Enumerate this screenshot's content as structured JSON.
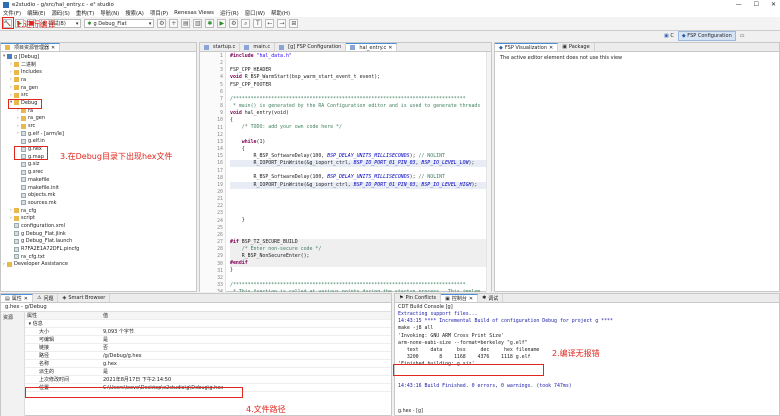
{
  "window": {
    "title": "e2studio - g/src/hal_entry.c - e² studio"
  },
  "menu": [
    "文件(F)",
    "编辑(E)",
    "源码(S)",
    "重构(T)",
    "导航(N)",
    "搜索(A)",
    "项目(P)",
    "Renesas Views",
    "运行(R)",
    "窗口(W)",
    "帮助(H)"
  ],
  "toolbar": {
    "mode": "调试(B)",
    "config": "g Debug_Flat"
  },
  "project_explorer": {
    "title": "项目资源管理器",
    "items": [
      {
        "d": 0,
        "t": "▾",
        "icon": "proj",
        "label": "g [Debug]"
      },
      {
        "d": 1,
        "t": "›",
        "icon": "folder",
        "label": "二进制"
      },
      {
        "d": 1,
        "t": "›",
        "icon": "folder",
        "label": "Includes"
      },
      {
        "d": 1,
        "t": "›",
        "icon": "folder",
        "label": "ra"
      },
      {
        "d": 1,
        "t": "›",
        "icon": "folder",
        "label": "ra_gen"
      },
      {
        "d": 1,
        "t": "›",
        "icon": "folder",
        "label": "src"
      },
      {
        "d": 1,
        "t": "▾",
        "icon": "folder",
        "label": "Debug"
      },
      {
        "d": 2,
        "t": "›",
        "icon": "folder",
        "label": "ra"
      },
      {
        "d": 2,
        "t": "›",
        "icon": "folder",
        "label": "ra_gen"
      },
      {
        "d": 2,
        "t": "›",
        "icon": "folder",
        "label": "src"
      },
      {
        "d": 2,
        "t": "›",
        "icon": "file",
        "label": "g.elf - [arm/le]"
      },
      {
        "d": 2,
        "t": "",
        "icon": "file",
        "label": "g.elf.in"
      },
      {
        "d": 2,
        "t": "",
        "icon": "file",
        "label": "g.hex"
      },
      {
        "d": 2,
        "t": "",
        "icon": "file",
        "label": "g.map"
      },
      {
        "d": 2,
        "t": "",
        "icon": "file",
        "label": "g.siz"
      },
      {
        "d": 2,
        "t": "",
        "icon": "file",
        "label": "g.srec"
      },
      {
        "d": 2,
        "t": "",
        "icon": "file",
        "label": "makefile"
      },
      {
        "d": 2,
        "t": "",
        "icon": "file",
        "label": "makefile.init"
      },
      {
        "d": 2,
        "t": "",
        "icon": "file",
        "label": "objects.mk"
      },
      {
        "d": 2,
        "t": "",
        "icon": "file",
        "label": "sources.mk"
      },
      {
        "d": 1,
        "t": "›",
        "icon": "folder",
        "label": "ra_cfg"
      },
      {
        "d": 1,
        "t": "›",
        "icon": "folder",
        "label": "script"
      },
      {
        "d": 1,
        "t": "",
        "icon": "file",
        "label": "configuration.xml"
      },
      {
        "d": 1,
        "t": "",
        "icon": "file",
        "label": "g Debug_Flat.jlink"
      },
      {
        "d": 1,
        "t": "",
        "icon": "file",
        "label": "g Debug_Flat.launch"
      },
      {
        "d": 1,
        "t": "",
        "icon": "file",
        "label": "R7FA2E1A72DFL.pincfg"
      },
      {
        "d": 1,
        "t": "",
        "icon": "file",
        "label": "ra_cfg.txt"
      },
      {
        "d": 0,
        "t": "›",
        "icon": "folder",
        "label": "Developer Assistance"
      }
    ]
  },
  "editor": {
    "tabs": [
      "startup.c",
      "main.c",
      "[g] FSP Configuration",
      "hal_entry.c"
    ],
    "lines": [
      [
        {
          "t": "#include ",
          "c": "kw"
        },
        {
          "t": "\"hal_data.h\"",
          "c": "st"
        }
      ],
      [],
      [
        {
          "t": "FSP_CPP_HEADER"
        }
      ],
      [
        {
          "t": "void ",
          "c": "kw"
        },
        {
          "t": "R_BSP_WarmStart(bsp_warm_start_event_t event);"
        }
      ],
      [
        {
          "t": "FSP_CPP_FOOTER"
        }
      ],
      [],
      [
        {
          "t": "/*******************************************************************************",
          "c": "cm"
        }
      ],
      [
        {
          "t": " * main() is generated by the RA Configuration editor and is used to generate threads",
          "c": "cm"
        }
      ],
      [
        {
          "t": "void ",
          "c": "kw"
        },
        {
          "t": "hal_entry(void)"
        }
      ],
      [
        {
          "t": "{"
        }
      ],
      [
        {
          "t": "    /* TODO: add your own code here */",
          "c": "cm"
        }
      ],
      [],
      [
        {
          "t": "    while",
          "c": "kw"
        },
        {
          "t": "(1)"
        }
      ],
      [
        {
          "t": "    {"
        }
      ],
      [
        {
          "t": "        R_BSP_SoftwareDelay(100, "
        },
        {
          "t": "BSP_DELAY_UNITS_MILLISECONDS",
          "c": "it"
        },
        {
          "t": "); "
        },
        {
          "t": "// NOLINT",
          "c": "cm"
        }
      ],
      [
        {
          "t": "        R_IOPORT_PinWrite(&g_ioport_ctrl, "
        },
        {
          "t": "BSP_IO_PORT_01_PIN_03",
          "c": "it"
        },
        {
          "t": ", "
        },
        {
          "t": "BSP_IO_LEVEL_LOW",
          "c": "it"
        },
        {
          "t": ");"
        }
      ],
      [],
      [
        {
          "t": "        R_BSP_SoftwareDelay(100, "
        },
        {
          "t": "BSP_DELAY_UNITS_MILLISECONDS",
          "c": "it"
        },
        {
          "t": "); "
        },
        {
          "t": "// NOLINT",
          "c": "cm"
        }
      ],
      [
        {
          "t": "        R_IOPORT_PinWrite(&g_ioport_ctrl, "
        },
        {
          "t": "BSP_IO_PORT_01_PIN_03",
          "c": "it"
        },
        {
          "t": ", "
        },
        {
          "t": "BSP_IO_LEVEL_HIGH",
          "c": "it"
        },
        {
          "t": ");"
        }
      ],
      [],
      [],
      [],
      [],
      [
        {
          "t": "    }"
        }
      ],
      [],
      [],
      [
        {
          "t": "#if ",
          "c": "kw"
        },
        {
          "t": "BSP_TZ_SECURE_BUILD"
        }
      ],
      [
        {
          "t": "    /* Enter non-secure code */",
          "c": "cm"
        }
      ],
      [
        {
          "t": "    R_BSP_NonSecureEnter();"
        }
      ],
      [
        {
          "t": "#endif",
          "c": "kw"
        }
      ],
      [
        {
          "t": "}"
        }
      ],
      [],
      [
        {
          "t": "/*******************************************************************************",
          "c": "cm"
        }
      ],
      [
        {
          "t": " * This function is called at various points during the startup process.  This implem",
          "c": "cm"
        }
      ],
      [
        {
          "t": "void ",
          "c": "kw"
        },
        {
          "t": "R_BSP_WarmStart(bsp_warm_start_event_t event)"
        }
      ],
      [
        {
          "t": "{"
        }
      ],
      [
        {
          "t": "    if ",
          "c": "kw"
        },
        {
          "t": "("
        },
        {
          "t": "BSP_WARM_START_RESET",
          "c": "it"
        },
        {
          "t": " == event)"
        }
      ],
      [
        {
          "t": "    {"
        }
      ],
      [
        {
          "t": "#if ",
          "c": "kw"
        },
        {
          "t": "BSP_FEATURE_FLASH_LP_VERSION != 0"
        }
      ]
    ]
  },
  "right_panel": {
    "tabs": [
      "FSP Visualization",
      "Package"
    ],
    "message": "The active editor element does not use this view",
    "perspectives": [
      "C",
      "FSP Configuration"
    ]
  },
  "properties": {
    "title": "g.hex - g/Debug",
    "tabs": [
      "属性",
      "问题",
      "Smart Browser"
    ],
    "side_label": "资源",
    "col_prop": "属性",
    "col_val": "值",
    "group": "信息",
    "rows": [
      [
        "大小",
        "9,093 个字节"
      ],
      [
        "可编辑",
        "是"
      ],
      [
        "链接",
        "否"
      ],
      [
        "路径",
        "/g/Debug/g.hex"
      ],
      [
        "名称",
        "g.hex"
      ],
      [
        "派生的",
        "是"
      ],
      [
        "上次修改时间",
        "2021年8月17日 下午2:14:50"
      ],
      [
        "位置",
        "C:\\Users\\leovo\\Desktop\\e2studio\\g\\Debug\\g.hex"
      ]
    ]
  },
  "console": {
    "tabs": [
      "Pin Conflicts",
      "控制台",
      "调试"
    ],
    "title": "CDT Build Console [g]",
    "lines": [
      {
        "t": "Extracting support files...",
        "c": "blue"
      },
      {
        "t": "14:43:15 **** Incremental Build of configuration Debug for project g ****",
        "c": "blue"
      },
      {
        "t": "make -j8 all",
        "c": ""
      },
      {
        "t": "'Invoking: GNU ARM Cross Print Size'",
        "c": ""
      },
      {
        "t": "arm-none-eabi-size --format=berkeley \"g.elf\"",
        "c": ""
      },
      {
        "t": "   text    data     bss     dec     hex filename",
        "c": ""
      },
      {
        "t": "   3200       8    1168    4376    1118 g.elf",
        "c": ""
      },
      {
        "t": "'Finished building: g.siz'",
        "c": ""
      },
      {
        "t": "",
        "c": ""
      },
      {
        "t": "",
        "c": ""
      },
      {
        "t": "14:43:16 Build Finished. 0 errors, 0 warnings. (took 747ms)",
        "c": "blue"
      }
    ],
    "footer_tab": "g.hex - [g]"
  },
  "annotations": {
    "step1": "1.进行编译",
    "step2": "2.编译无报错",
    "step3": "3.在Debug目录下出现hex文件",
    "step4": "4.文件路径"
  }
}
